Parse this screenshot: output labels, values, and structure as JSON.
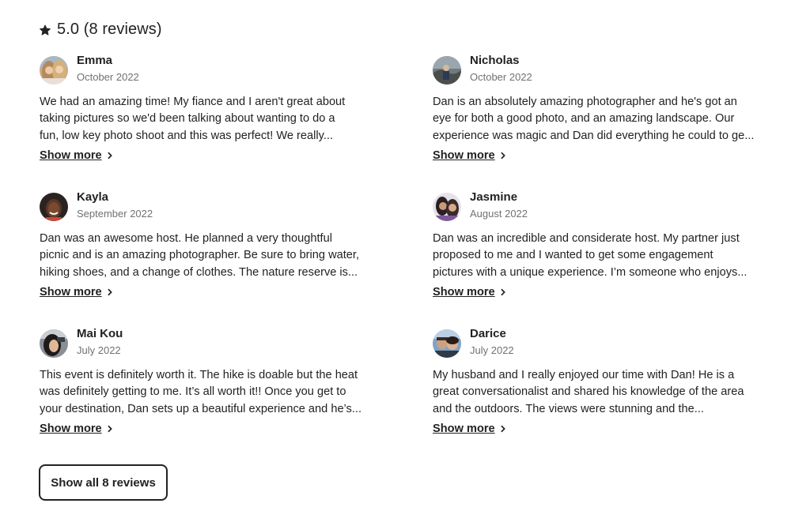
{
  "summary": {
    "rating_text": "5.0 (8 reviews)"
  },
  "reviews": [
    {
      "name": "Emma",
      "date": "October 2022",
      "lines": [
        "We had an amazing time! My fiance and I aren't great about",
        "taking pictures so we'd been talking about wanting to do a",
        "fun, low key photo shoot and this was perfect! We really..."
      ],
      "show_more": "Show more"
    },
    {
      "name": "Nicholas",
      "date": "October 2022",
      "lines": [
        "Dan is an absolutely amazing photographer and he's got an",
        "eye for both a good photo, and an amazing landscape. Our",
        "experience was magic and Dan did everything he could to ge..."
      ],
      "show_more": "Show more"
    },
    {
      "name": "Kayla",
      "date": "September 2022",
      "lines": [
        "Dan was an awesome host. He planned a very thoughtful",
        "picnic and is an amazing photographer. Be sure to bring water,",
        "hiking shoes, and a change of clothes. The nature reserve is..."
      ],
      "show_more": "Show more"
    },
    {
      "name": "Jasmine",
      "date": "August 2022",
      "lines": [
        "Dan was an incredible and considerate host. My partner just",
        "proposed to me and I wanted to get some engagement",
        "pictures with a unique experience. I’m someone who enjoys..."
      ],
      "show_more": "Show more"
    },
    {
      "name": "Mai Kou",
      "date": "July 2022",
      "lines": [
        "This event is definitely worth it. The hike is doable but the heat",
        "was definitely getting to me. It’s all worth it!! Once you get to",
        "your destination, Dan sets up a beautiful experience and he’s..."
      ],
      "show_more": "Show more"
    },
    {
      "name": "Darice",
      "date": "July 2022",
      "lines": [
        "My husband and I really enjoyed our time with Dan! He is a",
        "great conversationalist and shared his knowledge of the area",
        "and the outdoors. The views were stunning and the..."
      ],
      "show_more": "Show more"
    }
  ],
  "show_all_label": "Show all 8 reviews",
  "icons": {
    "rating": "star-icon",
    "show_more": "chevron-right-icon"
  }
}
